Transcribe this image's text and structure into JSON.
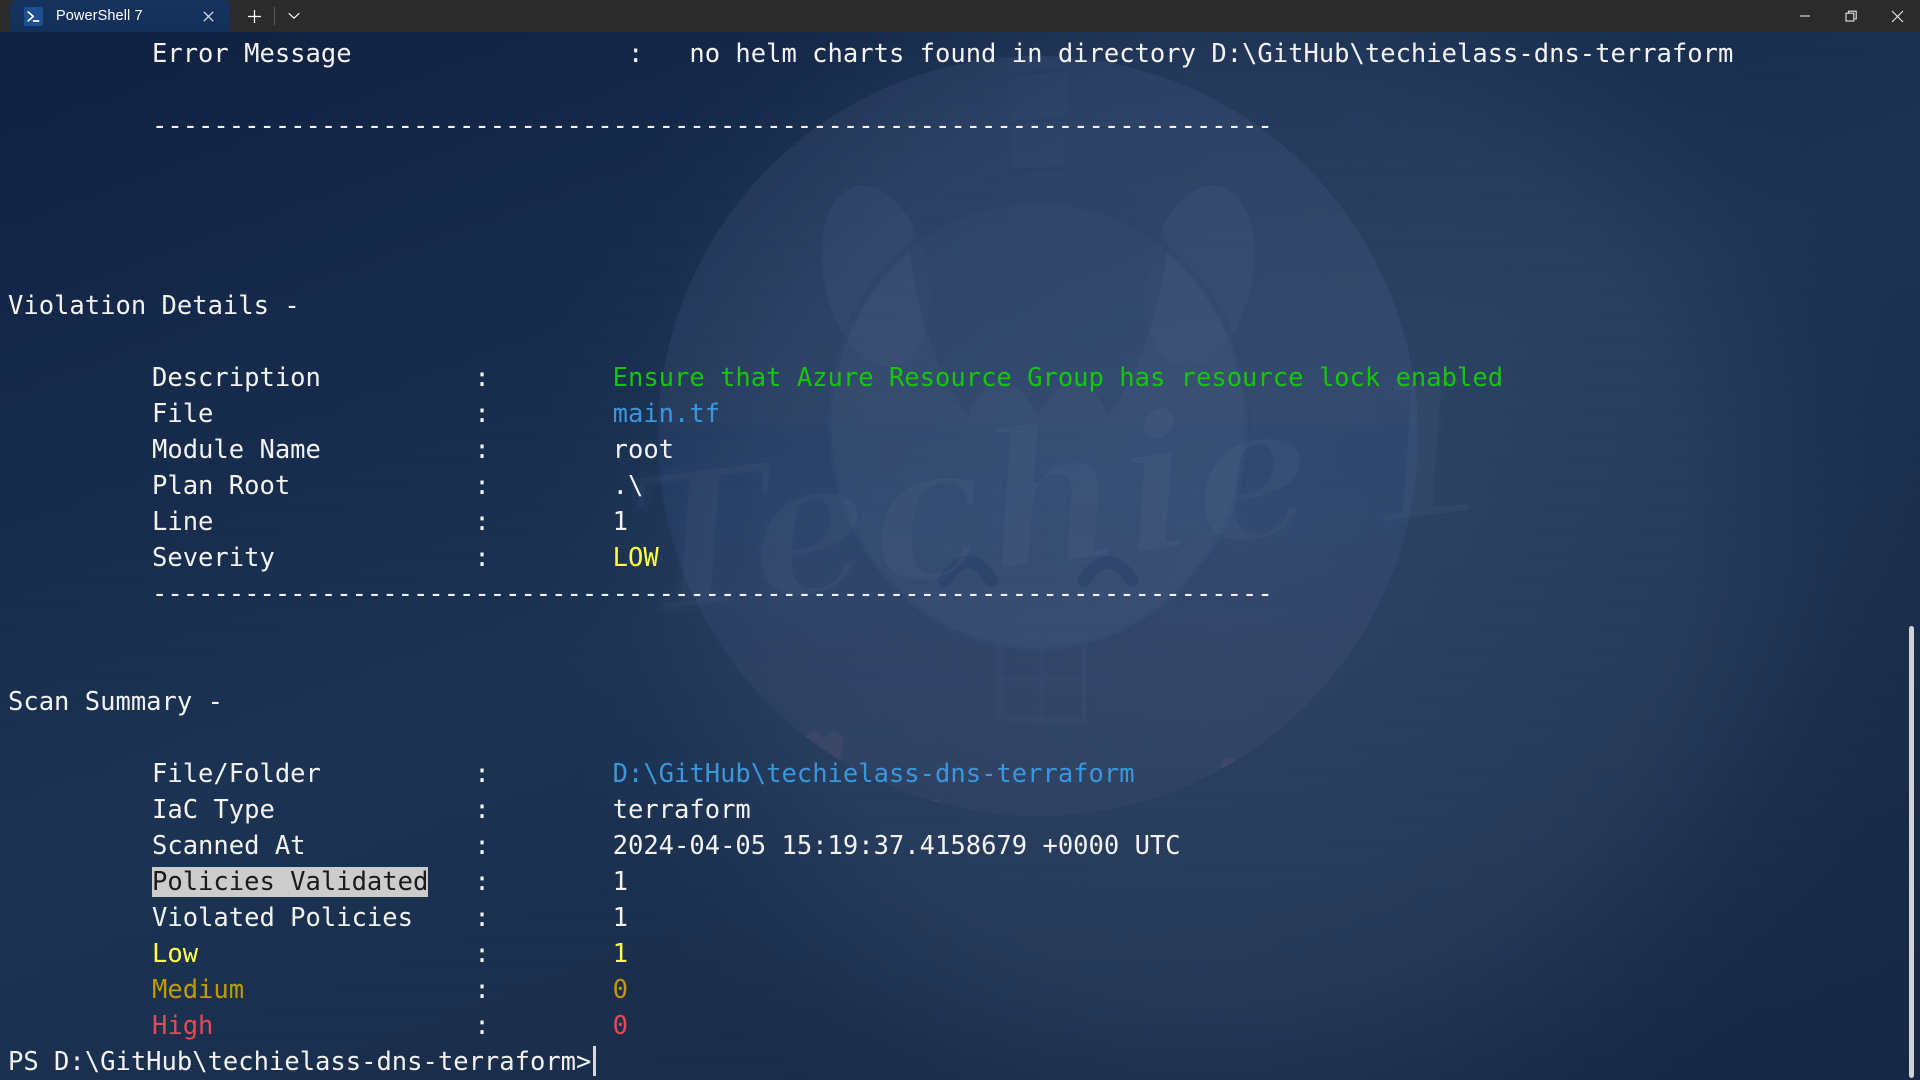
{
  "window": {
    "tab_title": "PowerShell 7",
    "tab_icon": "powershell-icon",
    "close_tab_icon": "close-icon",
    "new_tab_icon": "plus-icon",
    "tab_menu_icon": "chevron-down-icon",
    "minimize_icon": "minimize-icon",
    "maximize_icon": "restore-icon",
    "close_icon": "close-icon",
    "colors": {
      "titlebar_bg": "#2b2b2b",
      "active_tab_bg": "#13315c",
      "terminal_bg": "#132747",
      "accent_green": "#16c60c",
      "accent_cyan": "#3a96dd",
      "accent_yellow": "#ffff44",
      "accent_dark_yellow": "#c19c00",
      "accent_red": "#e74856",
      "selection_bg": "#cccccc"
    }
  },
  "terminal": {
    "error": {
      "label": "Error Message",
      "separator": ":",
      "value": "no helm charts found in directory D:\\GitHub\\techielass-dns-terraform"
    },
    "rule_top": "-------------------------------------------------------------------------",
    "violation_section": {
      "heading": "Violation Details -",
      "rows": [
        {
          "label": "Description",
          "separator": ":",
          "value": "Ensure that Azure Resource Group has resource lock enabled",
          "color": "green"
        },
        {
          "label": "File",
          "separator": ":",
          "value": "main.tf",
          "color": "cyan"
        },
        {
          "label": "Module Name",
          "separator": ":",
          "value": "root",
          "color": "white"
        },
        {
          "label": "Plan Root",
          "separator": ":",
          "value": ".\\",
          "color": "white"
        },
        {
          "label": "Line",
          "separator": ":",
          "value": "1",
          "color": "white"
        },
        {
          "label": "Severity",
          "separator": ":",
          "value": "LOW",
          "color": "yellow"
        }
      ]
    },
    "rule_mid": "-------------------------------------------------------------------------",
    "summary_section": {
      "heading": "Scan Summary -",
      "rows": [
        {
          "label": "File/Folder",
          "separator": ":",
          "value": "D:\\GitHub\\techielass-dns-terraform",
          "color": "cyan",
          "label_color": "white",
          "selected": false
        },
        {
          "label": "IaC Type",
          "separator": ":",
          "value": "terraform",
          "color": "white",
          "label_color": "white",
          "selected": false
        },
        {
          "label": "Scanned At",
          "separator": ":",
          "value": "2024-04-05 15:19:37.4158679 +0000 UTC",
          "color": "white",
          "label_color": "white",
          "selected": false
        },
        {
          "label": "Policies Validated",
          "separator": ":",
          "value": "1",
          "color": "white",
          "label_color": "white",
          "selected": true
        },
        {
          "label": "Violated Policies",
          "separator": ":",
          "value": "1",
          "color": "white",
          "label_color": "white",
          "selected": false
        },
        {
          "label": "Low",
          "separator": ":",
          "value": "1",
          "color": "yellow",
          "label_color": "yellow",
          "selected": false
        },
        {
          "label": "Medium",
          "separator": ":",
          "value": "0",
          "color": "dark-yellow",
          "label_color": "dark-yellow",
          "selected": false
        },
        {
          "label": "High",
          "separator": ":",
          "value": "0",
          "color": "red",
          "label_color": "red",
          "selected": false
        }
      ]
    },
    "prompt": {
      "text": "PS D:\\GitHub\\techielass-dns-terraform>",
      "cursor": true
    }
  },
  "scrollbar": {
    "name": "vertical-scrollbar"
  },
  "watermark": {
    "alt": "techie-lass-unicorn-logo"
  }
}
